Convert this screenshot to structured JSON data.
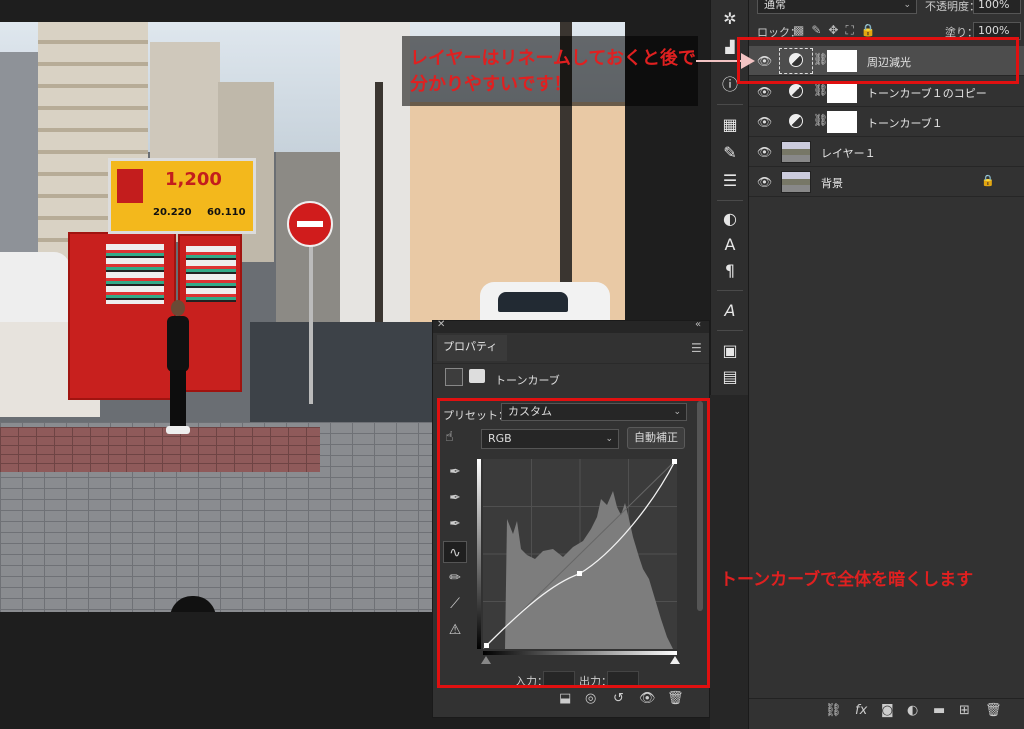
{
  "annotations": {
    "layer_note": "レイヤーはリネームしておくと後で分かりやすいです！",
    "curve_note": "トーンカーブで全体を暗くします"
  },
  "photo_signs": {
    "billboard_price": "1,200",
    "billboard_price_2": "20.220",
    "billboard_price_3": "60.110"
  },
  "layers_panel": {
    "blend_mode": "通常",
    "opacity_label": "不透明度：",
    "opacity_value": "100%",
    "lock_label": "ロック：",
    "fill_label": "塗り：",
    "fill_value": "100%",
    "layers": [
      {
        "name": "周辺減光",
        "kind": "adjustment",
        "selected": true
      },
      {
        "name": "トーンカーブ１のコピー",
        "kind": "adjustment",
        "selected": false
      },
      {
        "name": "トーンカーブ１",
        "kind": "adjustment",
        "selected": false
      },
      {
        "name": "レイヤー１",
        "kind": "image",
        "selected": false
      },
      {
        "name": "背景",
        "kind": "image",
        "locked": true,
        "selected": false
      }
    ]
  },
  "properties_panel": {
    "tab_label": "プロパティ",
    "title": "トーンカーブ",
    "preset_label": "プリセット：",
    "preset_value": "カスタム",
    "channel_value": "RGB",
    "auto_button": "自動補正",
    "input_label": "入力：",
    "output_label": "出力："
  },
  "icons": {
    "toolbar": [
      "histogram-icon",
      "info-icon",
      "swatches-icon",
      "brush-settings-icon",
      "adjustments-icon",
      "character-icon",
      "paragraph-icon",
      "glyphs-icon",
      "libraries-icon",
      "notes-icon"
    ]
  },
  "colors": {
    "annotation_red": "#e02020",
    "panel_bg": "#323232"
  }
}
